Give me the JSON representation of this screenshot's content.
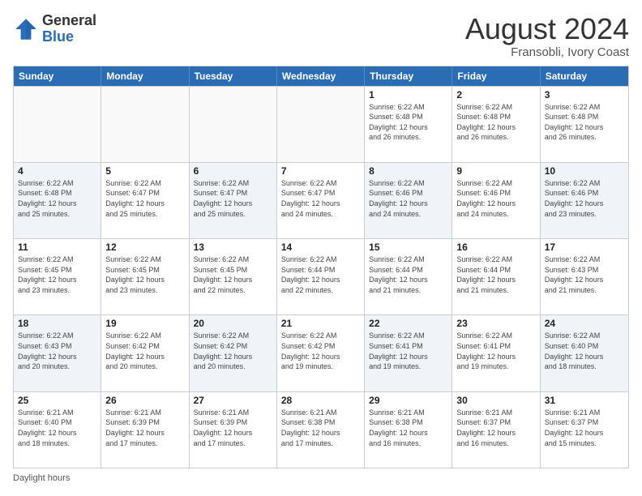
{
  "logo": {
    "general": "General",
    "blue": "Blue"
  },
  "title": "August 2024",
  "subtitle": "Fransobli, Ivory Coast",
  "header_days": [
    "Sunday",
    "Monday",
    "Tuesday",
    "Wednesday",
    "Thursday",
    "Friday",
    "Saturday"
  ],
  "weeks": [
    [
      {
        "day": "",
        "info": "",
        "empty": true
      },
      {
        "day": "",
        "info": "",
        "empty": true
      },
      {
        "day": "",
        "info": "",
        "empty": true
      },
      {
        "day": "",
        "info": "",
        "empty": true
      },
      {
        "day": "1",
        "info": "Sunrise: 6:22 AM\nSunset: 6:48 PM\nDaylight: 12 hours\nand 26 minutes."
      },
      {
        "day": "2",
        "info": "Sunrise: 6:22 AM\nSunset: 6:48 PM\nDaylight: 12 hours\nand 26 minutes."
      },
      {
        "day": "3",
        "info": "Sunrise: 6:22 AM\nSunset: 6:48 PM\nDaylight: 12 hours\nand 26 minutes."
      }
    ],
    [
      {
        "day": "4",
        "info": "Sunrise: 6:22 AM\nSunset: 6:48 PM\nDaylight: 12 hours\nand 25 minutes."
      },
      {
        "day": "5",
        "info": "Sunrise: 6:22 AM\nSunset: 6:47 PM\nDaylight: 12 hours\nand 25 minutes."
      },
      {
        "day": "6",
        "info": "Sunrise: 6:22 AM\nSunset: 6:47 PM\nDaylight: 12 hours\nand 25 minutes."
      },
      {
        "day": "7",
        "info": "Sunrise: 6:22 AM\nSunset: 6:47 PM\nDaylight: 12 hours\nand 24 minutes."
      },
      {
        "day": "8",
        "info": "Sunrise: 6:22 AM\nSunset: 6:46 PM\nDaylight: 12 hours\nand 24 minutes."
      },
      {
        "day": "9",
        "info": "Sunrise: 6:22 AM\nSunset: 6:46 PM\nDaylight: 12 hours\nand 24 minutes."
      },
      {
        "day": "10",
        "info": "Sunrise: 6:22 AM\nSunset: 6:46 PM\nDaylight: 12 hours\nand 23 minutes."
      }
    ],
    [
      {
        "day": "11",
        "info": "Sunrise: 6:22 AM\nSunset: 6:45 PM\nDaylight: 12 hours\nand 23 minutes."
      },
      {
        "day": "12",
        "info": "Sunrise: 6:22 AM\nSunset: 6:45 PM\nDaylight: 12 hours\nand 23 minutes."
      },
      {
        "day": "13",
        "info": "Sunrise: 6:22 AM\nSunset: 6:45 PM\nDaylight: 12 hours\nand 22 minutes."
      },
      {
        "day": "14",
        "info": "Sunrise: 6:22 AM\nSunset: 6:44 PM\nDaylight: 12 hours\nand 22 minutes."
      },
      {
        "day": "15",
        "info": "Sunrise: 6:22 AM\nSunset: 6:44 PM\nDaylight: 12 hours\nand 21 minutes."
      },
      {
        "day": "16",
        "info": "Sunrise: 6:22 AM\nSunset: 6:44 PM\nDaylight: 12 hours\nand 21 minutes."
      },
      {
        "day": "17",
        "info": "Sunrise: 6:22 AM\nSunset: 6:43 PM\nDaylight: 12 hours\nand 21 minutes."
      }
    ],
    [
      {
        "day": "18",
        "info": "Sunrise: 6:22 AM\nSunset: 6:43 PM\nDaylight: 12 hours\nand 20 minutes."
      },
      {
        "day": "19",
        "info": "Sunrise: 6:22 AM\nSunset: 6:42 PM\nDaylight: 12 hours\nand 20 minutes."
      },
      {
        "day": "20",
        "info": "Sunrise: 6:22 AM\nSunset: 6:42 PM\nDaylight: 12 hours\nand 20 minutes."
      },
      {
        "day": "21",
        "info": "Sunrise: 6:22 AM\nSunset: 6:42 PM\nDaylight: 12 hours\nand 19 minutes."
      },
      {
        "day": "22",
        "info": "Sunrise: 6:22 AM\nSunset: 6:41 PM\nDaylight: 12 hours\nand 19 minutes."
      },
      {
        "day": "23",
        "info": "Sunrise: 6:22 AM\nSunset: 6:41 PM\nDaylight: 12 hours\nand 19 minutes."
      },
      {
        "day": "24",
        "info": "Sunrise: 6:22 AM\nSunset: 6:40 PM\nDaylight: 12 hours\nand 18 minutes."
      }
    ],
    [
      {
        "day": "25",
        "info": "Sunrise: 6:21 AM\nSunset: 6:40 PM\nDaylight: 12 hours\nand 18 minutes."
      },
      {
        "day": "26",
        "info": "Sunrise: 6:21 AM\nSunset: 6:39 PM\nDaylight: 12 hours\nand 17 minutes."
      },
      {
        "day": "27",
        "info": "Sunrise: 6:21 AM\nSunset: 6:39 PM\nDaylight: 12 hours\nand 17 minutes."
      },
      {
        "day": "28",
        "info": "Sunrise: 6:21 AM\nSunset: 6:38 PM\nDaylight: 12 hours\nand 17 minutes."
      },
      {
        "day": "29",
        "info": "Sunrise: 6:21 AM\nSunset: 6:38 PM\nDaylight: 12 hours\nand 16 minutes."
      },
      {
        "day": "30",
        "info": "Sunrise: 6:21 AM\nSunset: 6:37 PM\nDaylight: 12 hours\nand 16 minutes."
      },
      {
        "day": "31",
        "info": "Sunrise: 6:21 AM\nSunset: 6:37 PM\nDaylight: 12 hours\nand 15 minutes."
      }
    ]
  ],
  "footer": "Daylight hours"
}
